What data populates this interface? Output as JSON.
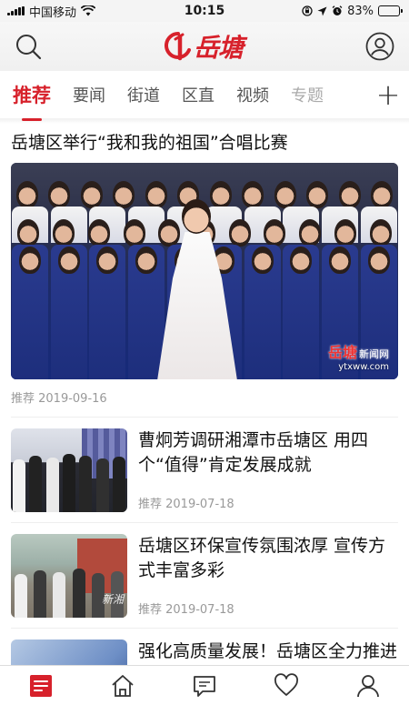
{
  "status_bar": {
    "carrier": "中国移动",
    "time": "10:15",
    "battery": "83%",
    "battery_level": 0.83
  },
  "header": {
    "logo_text": "岳塘",
    "brand_color": "#d7212b"
  },
  "tabs": {
    "items": [
      {
        "label": "推荐",
        "active": true
      },
      {
        "label": "要闻"
      },
      {
        "label": "街道"
      },
      {
        "label": "区直"
      },
      {
        "label": "视频"
      },
      {
        "label": "专题"
      }
    ],
    "add_label": "+"
  },
  "featured": {
    "title": "岳塘区举行“我和我的祖国”合唱比赛",
    "watermark_logo": "岳塘",
    "watermark_sub": "新闻网",
    "watermark_url": "ytxww.com",
    "meta": "推荐  2019-09-16"
  },
  "news": [
    {
      "title": "曹炯芳调研湘潭市岳塘区 用四个“值得”肯定发展成就",
      "meta": "推荐  2019-07-18"
    },
    {
      "title": "岳塘区环保宣传氛围浓厚 宣传方式丰富多彩",
      "meta": "推荐  2019-07-18",
      "watermark": "新湘"
    },
    {
      "title": "强化高质量发展！岳塘区全力推进产业项目建设工作",
      "meta": ""
    }
  ],
  "tabbar": {
    "icons": [
      "news-list-icon",
      "home-icon",
      "chat-icon",
      "heart-icon",
      "user-icon"
    ],
    "active_index": 0
  }
}
